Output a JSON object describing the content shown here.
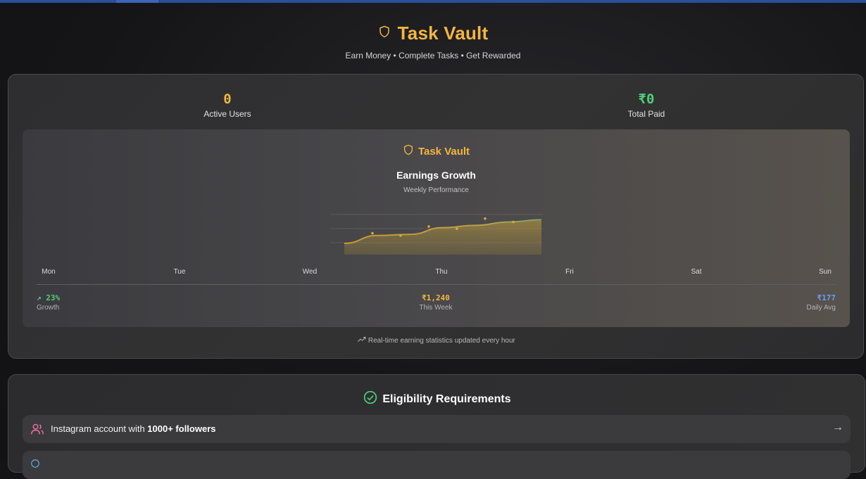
{
  "header": {
    "title": "Task Vault",
    "tagline": "Earn Money • Complete Tasks • Get Rewarded",
    "icon": "shield-icon"
  },
  "stats": {
    "active_users": {
      "value": "0",
      "label": "Active Users"
    },
    "total_paid": {
      "value": "₹0",
      "label": "Total Paid"
    }
  },
  "chart_card": {
    "brand": "Task Vault",
    "title": "Earnings Growth",
    "subtitle": "Weekly Performance",
    "footer_note": "Real-time earning statistics updated every hour"
  },
  "chart_data": {
    "type": "area",
    "title": "Earnings Growth",
    "subtitle": "Weekly Performance",
    "categories": [
      "Mon",
      "Tue",
      "Wed",
      "Thu",
      "Fri",
      "Sat",
      "Sun"
    ],
    "series": [
      {
        "values": [
          10,
          24,
          26,
          38,
          42,
          48,
          52
        ]
      }
    ],
    "points": [
      {
        "label": "",
        "value": 28
      },
      {
        "label": "",
        "value": 24
      },
      {
        "label": "",
        "value": 40
      },
      {
        "label": "",
        "value": 36
      },
      {
        "label": "",
        "value": 54
      },
      {
        "label": "",
        "value": 48
      }
    ],
    "ylim": [
      0,
      60
    ],
    "grid": true,
    "summary": [
      {
        "value": "↗ 23%",
        "label": "Growth"
      },
      {
        "value": "₹1,240",
        "label": "This Week"
      },
      {
        "value": "₹177",
        "label": "Daily Avg"
      }
    ]
  },
  "eligibility": {
    "title": "Eligibility Requirements",
    "requirements": [
      {
        "prefix": "Instagram account with ",
        "bold": "1000+ followers",
        "arrow": "→"
      },
      {
        "prefix": "",
        "bold": "",
        "arrow": ""
      }
    ]
  },
  "colors": {
    "accent": "#f4b63f",
    "green": "#4ed07b",
    "blue": "#6c9cf0",
    "background": "#141416"
  }
}
